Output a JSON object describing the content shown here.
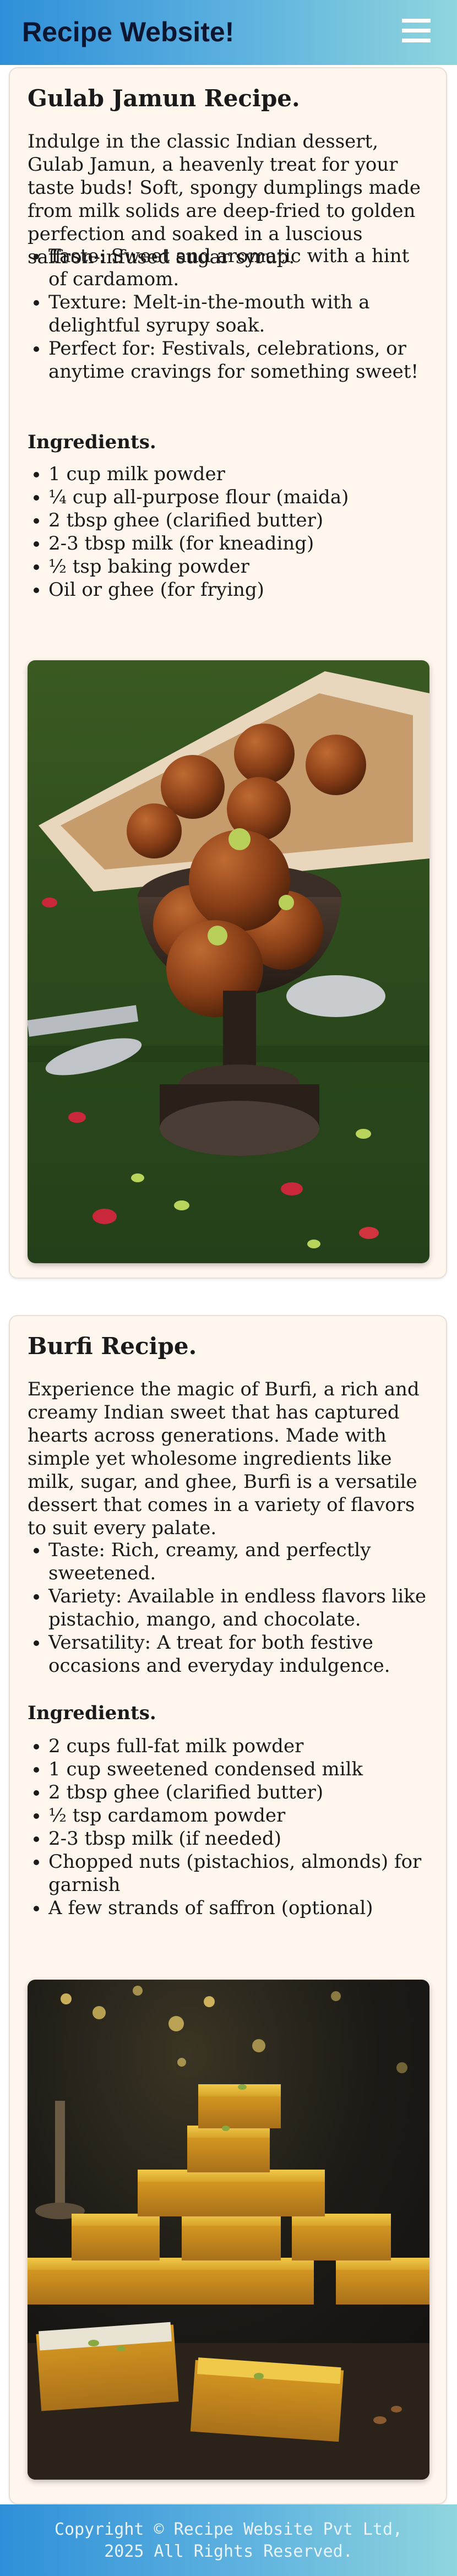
{
  "header": {
    "title": "Recipe Website!",
    "menu_icon": "hamburger-menu-icon"
  },
  "recipes": [
    {
      "title": "Gulab Jamun Recipe.",
      "intro": "Indulge in the classic Indian dessert, Gulab Jamun, a heavenly treat for your taste buds! Soft, spongy dumplings made from milk solids are deep-fried to golden perfection and soaked in a luscious saffron-infused sugar syrup.",
      "highlights": [
        "Taste: Sweet and aromatic with a hint of cardamom.",
        "Texture: Melt-in-the-mouth with a delightful syrupy soak.",
        "Perfect for: Festivals, celebrations, or anytime cravings for something sweet!"
      ],
      "ingredients_heading": "Ingredients.",
      "ingredients": [
        "1 cup milk powder",
        "¼ cup all-purpose flour (maida)",
        "2 tbsp ghee (clarified butter)",
        "2-3 tbsp milk (for kneading)",
        "½ tsp baking powder",
        "Oil or ghee (for frying)"
      ]
    },
    {
      "title": "Burfi Recipe.",
      "intro": "Experience the magic of Burfi, a rich and creamy Indian sweet that has captured hearts across generations. Made with simple yet wholesome ingredients like milk, sugar, and ghee, Burfi is a versatile dessert that comes in a variety of flavors to suit every palate.",
      "highlights": [
        "Taste: Rich, creamy, and perfectly sweetened.",
        "Variety: Available in endless flavors like pistachio, mango, and chocolate.",
        "Versatility: A treat for both festive occasions and everyday indulgence."
      ],
      "ingredients_heading": "Ingredients.",
      "ingredients": [
        "2 cups full-fat milk powder",
        "1 cup sweetened condensed milk",
        "2 tbsp ghee (clarified butter)",
        "½ tsp cardamom powder",
        "2-3 tbsp milk (if needed)",
        "Chopped nuts (pistachios, almonds) for garnish",
        "A few strands of saffron (optional)"
      ]
    }
  ],
  "footer": {
    "copyright": "Copyright © Recipe Website Pvt Ltd,\n2025 All Rights Reserved."
  },
  "colors": {
    "header_gradient_start": "#2f8fd8",
    "header_gradient_end": "#8fd5de",
    "card_bg": "#fff6ee"
  }
}
